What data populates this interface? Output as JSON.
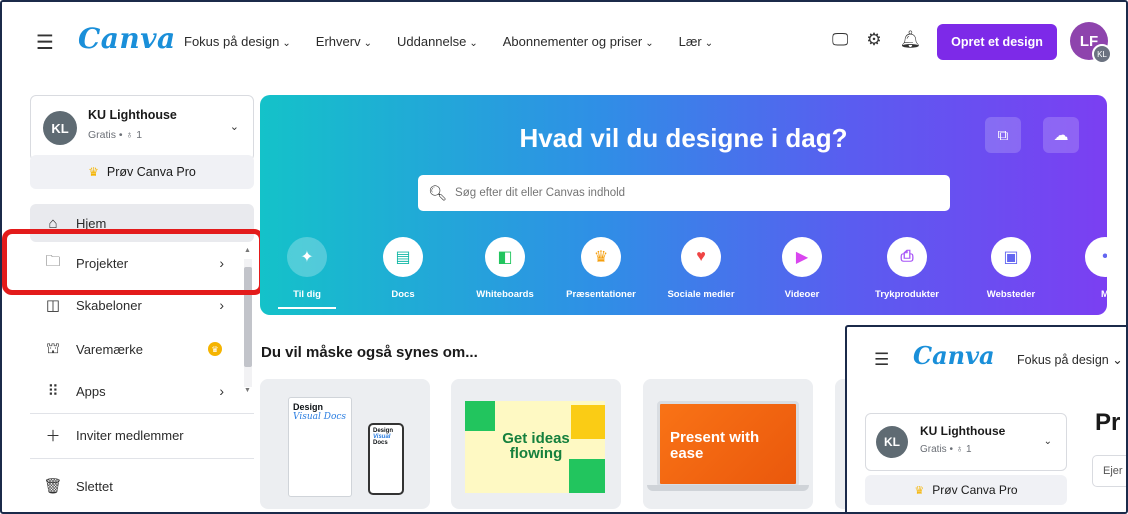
{
  "topnav": {
    "logo": "Canva",
    "links": [
      {
        "label": "Fokus på design"
      },
      {
        "label": "Erhverv"
      },
      {
        "label": "Uddannelse"
      },
      {
        "label": "Abonnementer og priser"
      },
      {
        "label": "Lær"
      }
    ],
    "create_button": "Opret et design",
    "avatar_initials": "LF",
    "avatar_sub_initials": "KL"
  },
  "sidebar": {
    "account": {
      "initials": "KL",
      "name": "KU Lighthouse",
      "plan": "Gratis • ♁ 1"
    },
    "try_pro": "Prøv Canva Pro",
    "items": [
      {
        "label": "Hjem"
      },
      {
        "label": "Projekter"
      },
      {
        "label": "Skabeloner"
      },
      {
        "label": "Varemærke"
      },
      {
        "label": "Apps"
      },
      {
        "label": "Inviter medlemmer"
      },
      {
        "label": "Slettet"
      }
    ]
  },
  "banner": {
    "title": "Hvad vil du designe i dag?",
    "search_placeholder": "Søg efter dit eller Canvas indhold",
    "categories": [
      {
        "label": "Til dig",
        "color": "#3b82f6"
      },
      {
        "label": "Docs",
        "color": "#14b8a6"
      },
      {
        "label": "Whiteboards",
        "color": "#22c55e"
      },
      {
        "label": "Præsentationer",
        "color": "#f59e0b"
      },
      {
        "label": "Sociale medier",
        "color": "#ef4444"
      },
      {
        "label": "Videoer",
        "color": "#d946ef"
      },
      {
        "label": "Trykprodukter",
        "color": "#a855f7"
      },
      {
        "label": "Websteder",
        "color": "#6366f1"
      },
      {
        "label": "M",
        "color": "#6366f1"
      }
    ]
  },
  "suggestions": {
    "title": "Du vil måske også synes om...",
    "card1": {
      "line1": "Design",
      "line2": "Visual Docs",
      "mini1": "Design",
      "mini2": "Visual",
      "mini3": "Docs"
    },
    "card2": {
      "text": "Get ideas flowing"
    },
    "card3": {
      "text": "Present with ease"
    }
  },
  "inset": {
    "logo": "Canva",
    "nav": "Fokus på design ⌄",
    "account_initials": "KL",
    "account_name": "KU Lighthouse",
    "account_plan": "Gratis • ♁ 1",
    "try_pro": "Prøv Canva Pro",
    "heading": "Pr",
    "filter": "Ejer"
  },
  "colors": {
    "accent": "#7d2ae8",
    "highlight": "#e31b1b",
    "logo": "#1a8fd9"
  }
}
